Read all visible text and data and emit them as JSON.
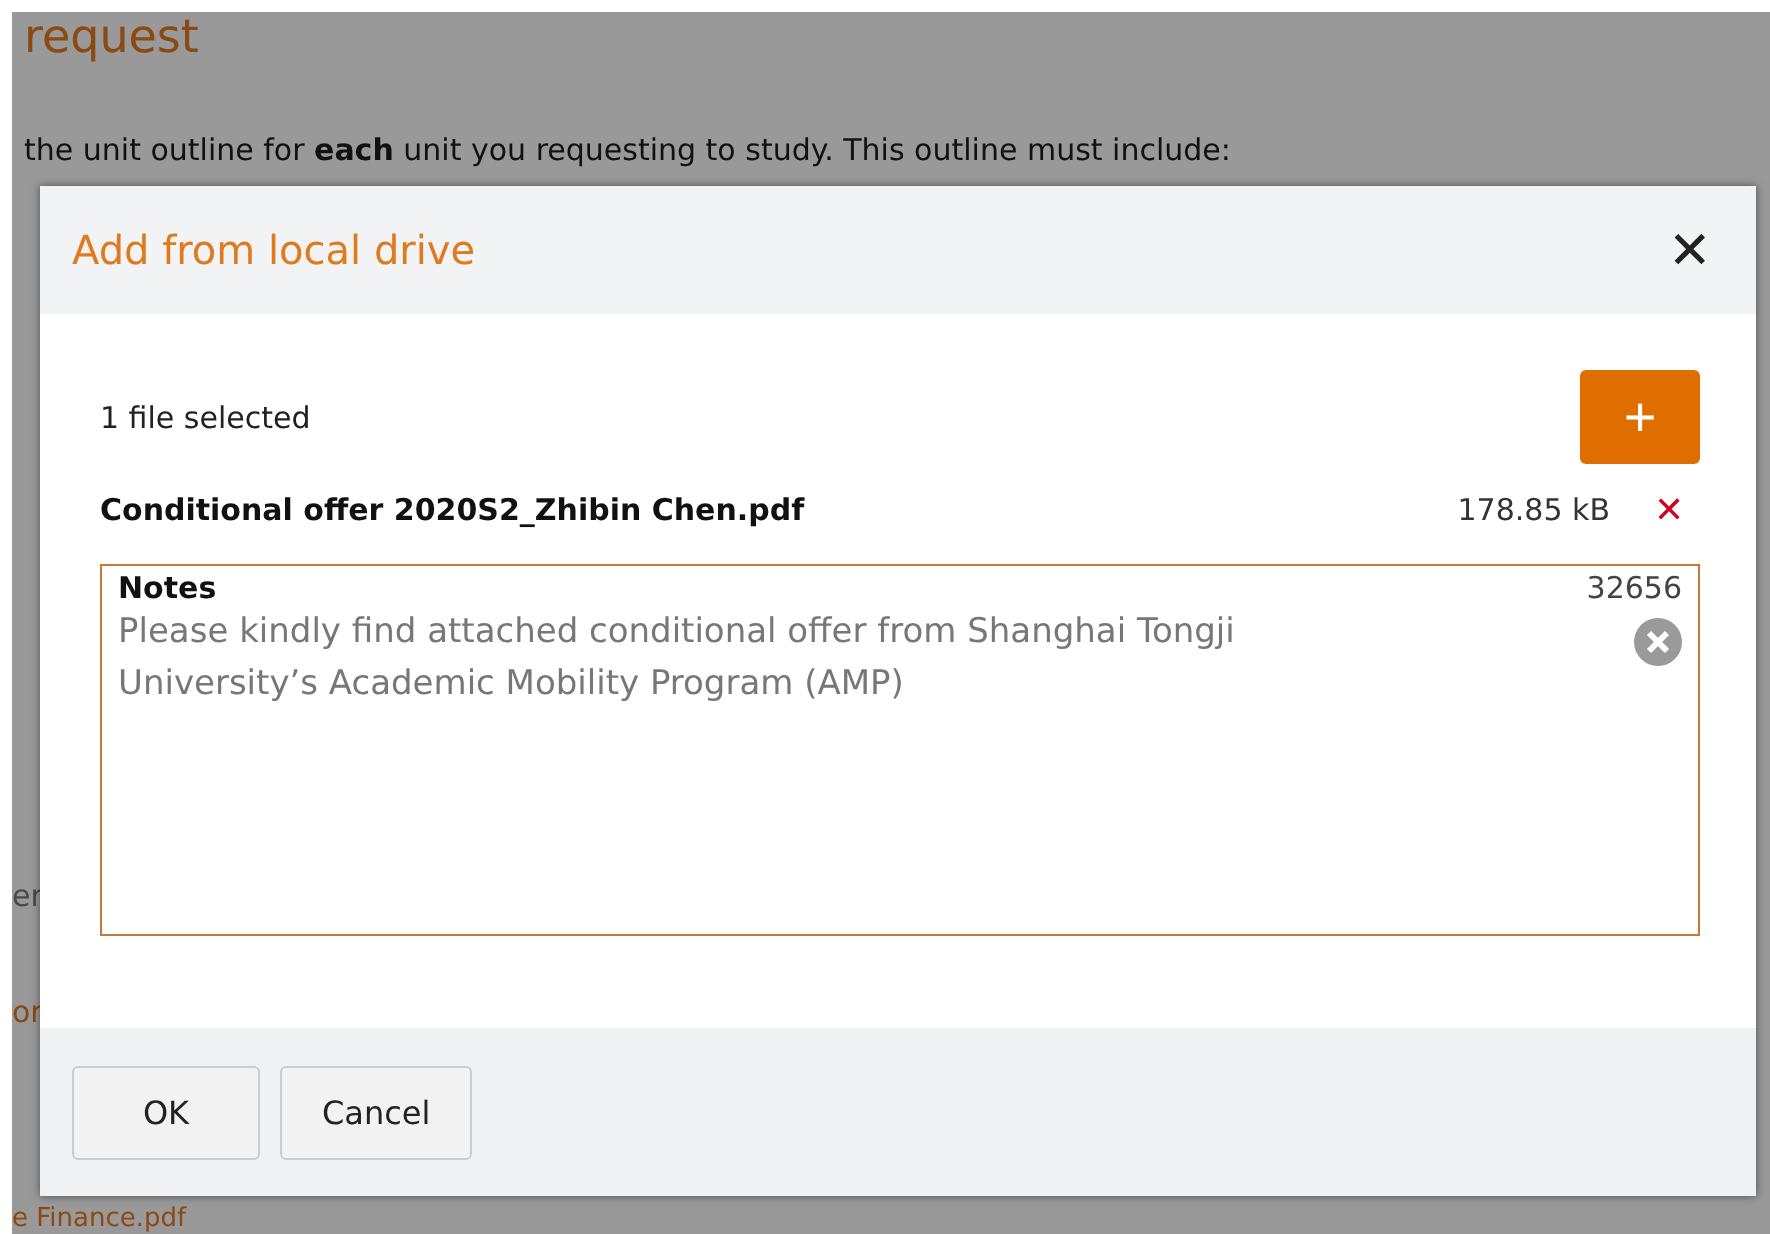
{
  "background_page": {
    "heading": "request",
    "intro": "the unit outline for **each** unit you requesting to study. This outline must include:",
    "fragments": [
      "er",
      "or",
      "e Finance.pdf"
    ]
  },
  "dialog": {
    "title": "Add from local drive",
    "close_symbol": "✕",
    "selection_count": "1 file selected",
    "add_symbol": "+",
    "files": [
      {
        "name": "Conditional offer 2020S2_Zhibin Chen.pdf",
        "size": "178.85 kB",
        "remove_symbol": "✕"
      }
    ],
    "notes": {
      "label": "Notes",
      "counter": "32656",
      "value": "Please kindly find attached conditional offer from Shanghai Tongji University’s Academic Mobility Program (AMP)"
    },
    "buttons": [
      "OK",
      "Cancel"
    ]
  }
}
